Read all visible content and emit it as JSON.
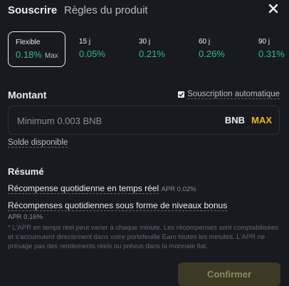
{
  "tabs": {
    "subscribe": "Souscrire",
    "rules": "Règles du produit"
  },
  "close_icon": "close-icon",
  "terms": [
    {
      "days": "Flexible",
      "rate": "0.18%",
      "badge": "Max",
      "selected": true
    },
    {
      "days": "15 j",
      "rate": "0.05%"
    },
    {
      "days": "30 j",
      "rate": "0.21%"
    },
    {
      "days": "60 j",
      "rate": "0.26%"
    },
    {
      "days": "90 j",
      "rate": "0.31%"
    }
  ],
  "amount": {
    "label": "Montant",
    "auto_subscribe": "Souscription automatique",
    "auto_subscribe_checked": true,
    "placeholder": "Minimum 0.003 BNB",
    "value": "",
    "unit": "BNB",
    "max_label": "MAX",
    "balance_label": "Solde disponible"
  },
  "summary": {
    "title": "Résumé",
    "daily_reward": "Récompense quotidienne en temps réel",
    "daily_reward_apr": "APR 0.02%",
    "bonus_reward": "Récompenses quotidiennes sous forme de niveaux bonus",
    "bonus_reward_apr": "APR 0.16%",
    "note": "* L'APR en temps réel peut varier à chaque minute. Les récompenses sont comptabilisées et s'accumulent directement dans votre portefeuille Earn toutes les minutes. L'APR ne présage pas des rendements réels ou prévus dans la monnaie fiat."
  },
  "confirm_label": "Confirmer",
  "colors": {
    "background": "#181a20",
    "accent": "#f0b90b",
    "positive": "#2ebd85"
  }
}
